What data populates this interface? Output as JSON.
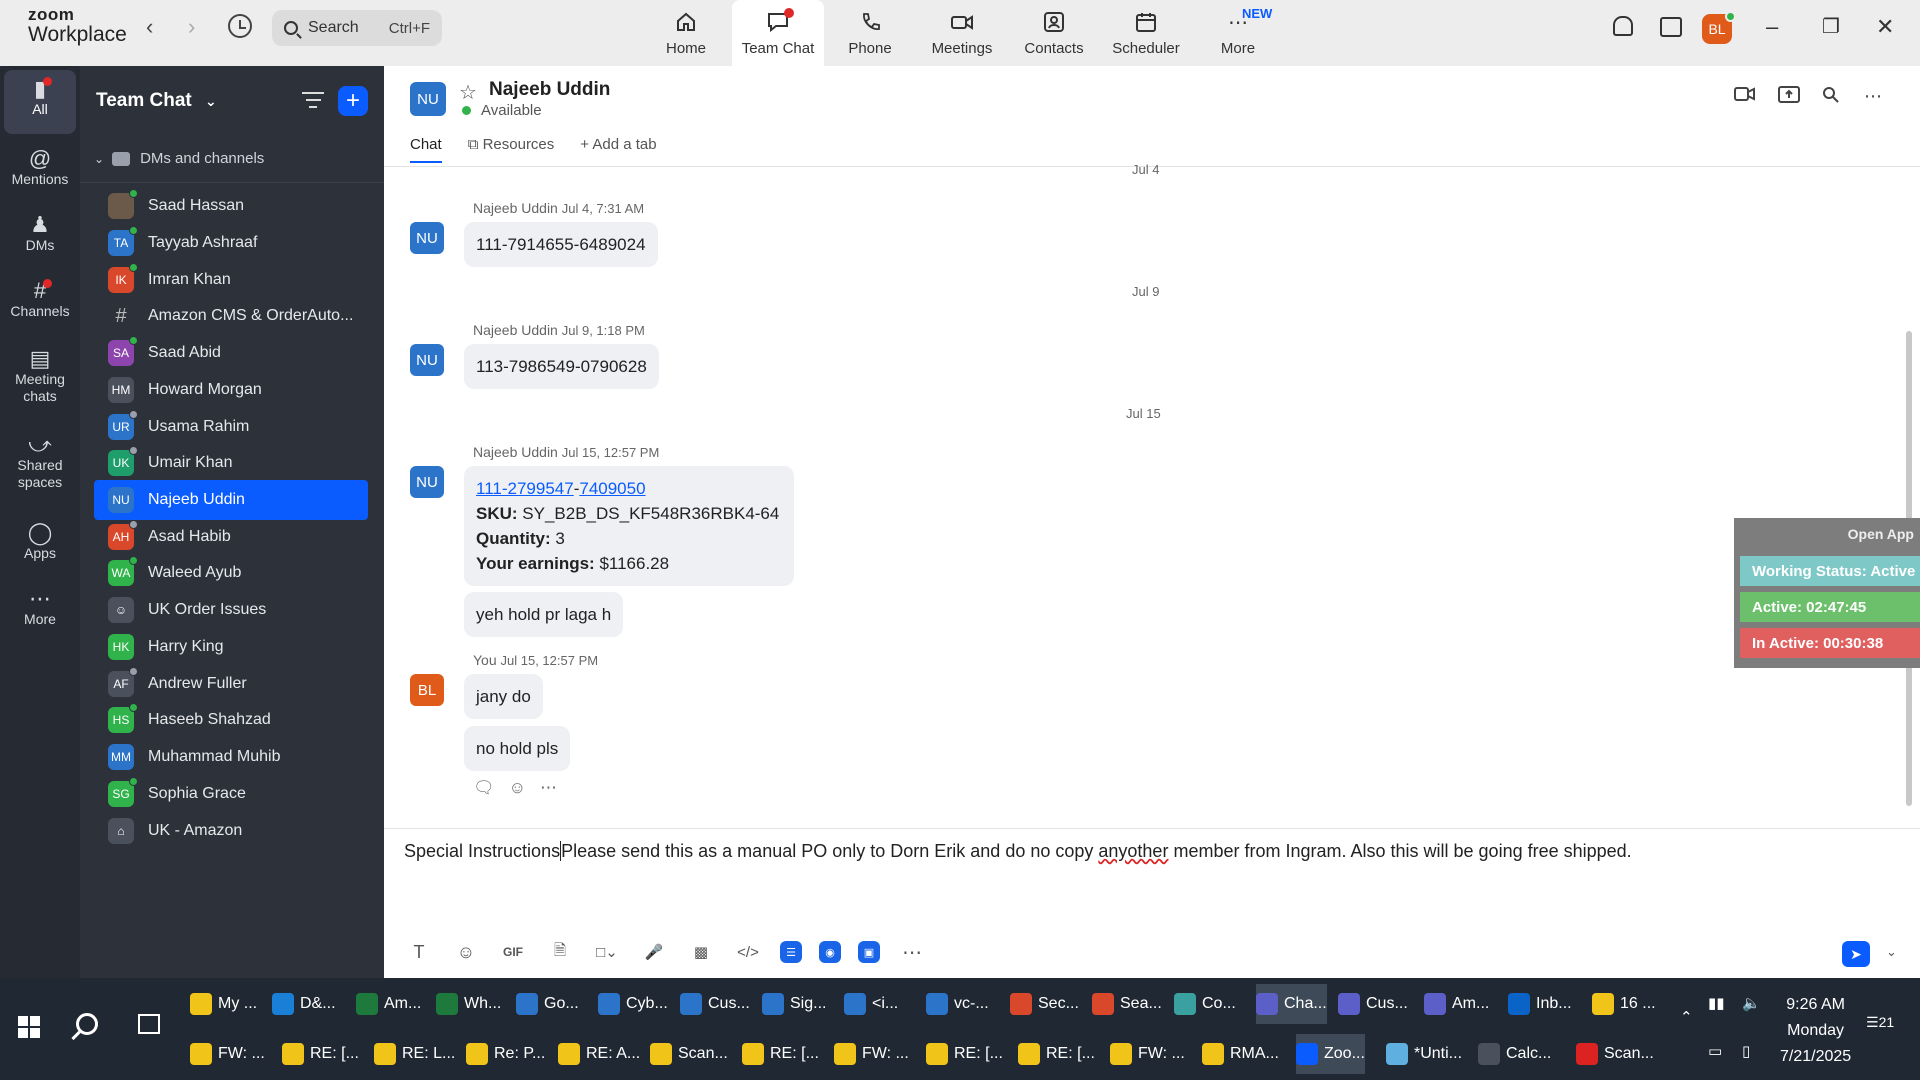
{
  "app": {
    "logo_line1": "zoom",
    "logo_line2": "Workplace",
    "search_placeholder": "Search",
    "search_shortcut": "Ctrl+F",
    "user_initials": "BL",
    "nav_tabs": [
      {
        "label": "Home",
        "icon": "home-icon"
      },
      {
        "label": "Team Chat",
        "icon": "chat-icon"
      },
      {
        "label": "Phone",
        "icon": "phone-icon"
      },
      {
        "label": "Meetings",
        "icon": "video-icon"
      },
      {
        "label": "Contacts",
        "icon": "contacts-icon"
      },
      {
        "label": "Scheduler",
        "icon": "scheduler-icon"
      },
      {
        "label": "More",
        "icon": "more-dots-icon"
      }
    ],
    "new_badge": "NEW"
  },
  "rail": [
    {
      "label": "All",
      "icon": "chat-bubble-icon"
    },
    {
      "label": "Mentions",
      "icon": "at-icon"
    },
    {
      "label": "DMs",
      "icon": "people-icon"
    },
    {
      "label": "Channels",
      "icon": "hash-icon"
    },
    {
      "label": "Meeting chats",
      "icon": "calendar-icon"
    },
    {
      "label": "Shared spaces",
      "icon": "share-icon"
    },
    {
      "label": "Apps",
      "icon": "apps-icon"
    },
    {
      "label": "More",
      "icon": "ellipsis-icon"
    }
  ],
  "sidebar": {
    "title": "Team Chat",
    "section": "DMs and channels",
    "items": [
      {
        "initials": "",
        "name": "Saad Hassan",
        "color": "#6b5a4a",
        "kind": "photo",
        "status": "online"
      },
      {
        "initials": "TA",
        "name": "Tayyab Ashraaf",
        "color": "#2b74c9",
        "kind": "person",
        "status": "online"
      },
      {
        "initials": "IK",
        "name": "Imran Khan",
        "color": "#d9482b",
        "kind": "person",
        "status": "online"
      },
      {
        "initials": "#",
        "name": "Amazon CMS & OrderAuto...",
        "color": "",
        "kind": "channel",
        "status": ""
      },
      {
        "initials": "SA",
        "name": "Saad Abid",
        "color": "#8e44ad",
        "kind": "person",
        "status": "online"
      },
      {
        "initials": "HM",
        "name": "Howard Morgan",
        "color": "#4a505c",
        "kind": "person",
        "status": ""
      },
      {
        "initials": "UR",
        "name": "Usama Rahim",
        "color": "#2b74c9",
        "kind": "person",
        "status": "away"
      },
      {
        "initials": "UK",
        "name": "Umair Khan",
        "color": "#1e9e6a",
        "kind": "person",
        "status": "away"
      },
      {
        "initials": "NU",
        "name": "Najeeb Uddin",
        "color": "#2b74c9",
        "kind": "person",
        "status": ""
      },
      {
        "initials": "AH",
        "name": "Asad Habib",
        "color": "#d9482b",
        "kind": "person",
        "status": "away"
      },
      {
        "initials": "WA",
        "name": "Waleed Ayub",
        "color": "#2fb34a",
        "kind": "person",
        "status": "online"
      },
      {
        "initials": "",
        "name": "UK Order Issues",
        "color": "#4a505c",
        "kind": "group",
        "status": ""
      },
      {
        "initials": "HK",
        "name": "Harry King",
        "color": "#2fb34a",
        "kind": "person",
        "status": ""
      },
      {
        "initials": "AF",
        "name": "Andrew Fuller",
        "color": "#4a505c",
        "kind": "person",
        "status": "away"
      },
      {
        "initials": "HS",
        "name": "Haseeb Shahzad",
        "color": "#2fb34a",
        "kind": "person",
        "status": "online"
      },
      {
        "initials": "MM",
        "name": "Muhammad Muhib",
        "color": "#2b74c9",
        "kind": "person",
        "status": ""
      },
      {
        "initials": "SG",
        "name": "Sophia Grace",
        "color": "#2fb34a",
        "kind": "person",
        "status": "online"
      },
      {
        "initials": "",
        "name": "UK - Amazon",
        "color": "#4a505c",
        "kind": "lock",
        "status": ""
      }
    ]
  },
  "chat": {
    "contact_initials": "NU",
    "contact_name": "Najeeb Uddin",
    "contact_status": "Available",
    "tabs": [
      "Chat",
      "Resources",
      "Add a tab"
    ],
    "dates": [
      "Jul 4",
      "Jul 9",
      "Jul 15"
    ],
    "messages": [
      {
        "sender": "Najeeb Uddin",
        "time": "Jul 4, 7:31 AM",
        "text": "111-7914655-6489024"
      },
      {
        "sender": "Najeeb Uddin",
        "time": "Jul 9, 1:18 PM",
        "text": "113-7986549-0790628"
      },
      {
        "sender": "Najeeb Uddin",
        "time": "Jul 15, 12:57 PM",
        "order_link_a": "111-2799547",
        "order_dash": "-",
        "order_link_b": "7409050",
        "sku_label": "SKU:",
        "sku_value": "SY_B2B_DS_KF548R36RBK4-64",
        "qty_label": "Quantity:",
        "qty_value": "3",
        "earn_label": "Your earnings:",
        "earn_value": "$1166.28",
        "followup": "yeh hold pr laga h"
      },
      {
        "sender": "You",
        "time": "Jul 15, 12:57 PM",
        "initials": "BL",
        "texts": [
          "jany do",
          "no hold pls"
        ]
      }
    ],
    "compose_pre": "Special Instructions",
    "compose_mid": "Please send this as a manual PO only to Dorn Erik and do no copy ",
    "compose_misspelled": "anyother",
    "compose_post": " member from Ingram. Also this will be going free shipped."
  },
  "widget": {
    "open_label": "Open App",
    "working": "Working Status: Active",
    "active": "Active: 02:47:45",
    "inactive": "In Active: 00:30:38",
    "colors": {
      "working": "#7fc8c8",
      "active": "#6cc06c",
      "inactive": "#e06060"
    }
  },
  "taskbar": {
    "row1": [
      {
        "label": "My ...",
        "color": "#f0c419"
      },
      {
        "label": "D&...",
        "color": "#1a7fd6"
      },
      {
        "label": "Am...",
        "color": "#1e7a3c"
      },
      {
        "label": "Wh...",
        "color": "#1e7a3c"
      },
      {
        "label": "Go...",
        "color": "#2b74c9"
      },
      {
        "label": "Cyb...",
        "color": "#2b74c9"
      },
      {
        "label": "Cus...",
        "color": "#2b74c9"
      },
      {
        "label": "Sig...",
        "color": "#2b74c9"
      },
      {
        "label": "<i...",
        "color": "#2b74c9"
      },
      {
        "label": "vc-...",
        "color": "#2b74c9"
      },
      {
        "label": "Sec...",
        "color": "#d9482b"
      },
      {
        "label": "Sea...",
        "color": "#d9482b"
      },
      {
        "label": "Co...",
        "color": "#3aa0a0"
      },
      {
        "label": "Cha...",
        "color": "#5b5fc7"
      },
      {
        "label": "Cus...",
        "color": "#5b5fc7"
      },
      {
        "label": "Am...",
        "color": "#5b5fc7"
      },
      {
        "label": "Inb...",
        "color": "#0a64c8"
      },
      {
        "label": "16 ...",
        "color": "#f0c419"
      }
    ],
    "row2": [
      {
        "label": "FW: ...",
        "color": "#f0c419"
      },
      {
        "label": "RE: [...",
        "color": "#f0c419"
      },
      {
        "label": "RE: L...",
        "color": "#f0c419"
      },
      {
        "label": "Re: P...",
        "color": "#f0c419"
      },
      {
        "label": "RE: A...",
        "color": "#f0c419"
      },
      {
        "label": "Scan...",
        "color": "#f0c419"
      },
      {
        "label": "RE: [...",
        "color": "#f0c419"
      },
      {
        "label": "FW: ...",
        "color": "#f0c419"
      },
      {
        "label": "RE: [...",
        "color": "#f0c419"
      },
      {
        "label": "RE: [...",
        "color": "#f0c419"
      },
      {
        "label": "FW: ...",
        "color": "#f0c419"
      },
      {
        "label": "RMA...",
        "color": "#f0c419"
      },
      {
        "label": "Zoo...",
        "color": "#0b5cff"
      },
      {
        "label": "*Unti...",
        "color": "#5fb0e0"
      },
      {
        "label": "Calc...",
        "color": "#4a505c"
      },
      {
        "label": "Scan...",
        "color": "#d22"
      }
    ],
    "time": "9:26 AM",
    "day": "Monday",
    "date": "7/21/2025",
    "notif_count": "21"
  }
}
